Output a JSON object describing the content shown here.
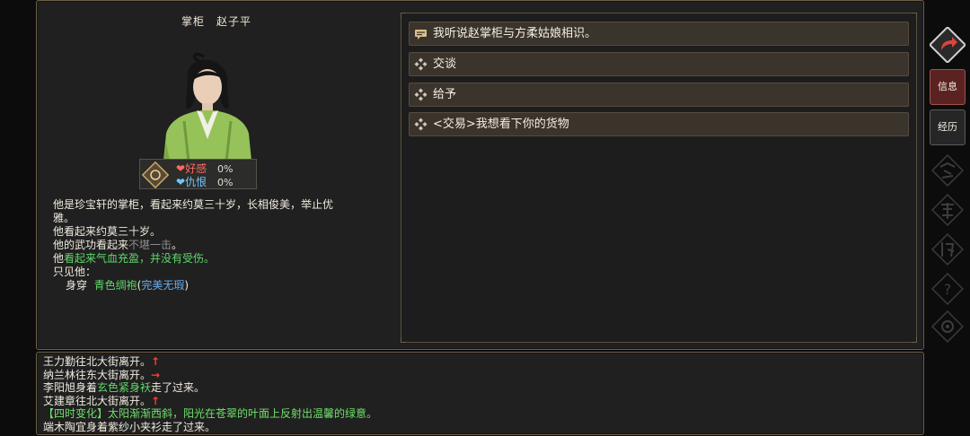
{
  "npc": {
    "title": "掌柜　赵子平",
    "affection_label": "好感",
    "affection_value": "0%",
    "hatred_label": "仇恨",
    "hatred_value": "0%",
    "description": {
      "line1": "他是珍宝轩的掌柜，看起来约莫三十岁，长相俊美，举止优",
      "line2": "雅。",
      "line3": "他看起来约莫三十岁。",
      "martial_prefix": "他的武功看起来",
      "martial_value": "不堪一击",
      "martial_suffix": "。",
      "health_prefix": "他",
      "health_value": "看起来气血充盈，并没有受伤。",
      "seen_label": "只见他：",
      "wear_label": "身穿",
      "wear_item": "青色绸袍",
      "wear_open": "(",
      "wear_quality": "完美无瑕",
      "wear_close": ")"
    }
  },
  "options": [
    {
      "label": "我听说赵掌柜与方柔姑娘相识。",
      "icon": "speech-icon"
    },
    {
      "label": "交谈",
      "icon": "diamond-icon"
    },
    {
      "label": "给予",
      "icon": "diamond-icon"
    },
    {
      "label": "<交易>我想看下你的货物",
      "icon": "diamond-icon"
    }
  ],
  "sidebar": {
    "info_label": "信息",
    "history_label": "经历"
  },
  "log": {
    "line1": "王力勤往北大街离开。",
    "line1_arrow": "↑",
    "line2": "纳兰林往东大街离开。",
    "line2_arrow": "→",
    "line3_prefix": "李阳旭身着",
    "line3_item": "玄色紧身袄",
    "line3_suffix": "走了过来。",
    "line4": "艾建章往北大街离开。",
    "line4_arrow": "↑",
    "line5": "【四时变化】太阳渐渐西斜，阳光在苍翠的叶面上反射出温馨的绿意。",
    "line6": "端木陶宜身着紫纱小夹衫走了过来。"
  },
  "colors": {
    "accent": "#a0524c",
    "affection": "#ff6a5e",
    "hatred": "#6fc6ff",
    "green_text": "#5fd86a",
    "blue_text": "#6ab0f0",
    "arrow": "#ff3b2f"
  }
}
